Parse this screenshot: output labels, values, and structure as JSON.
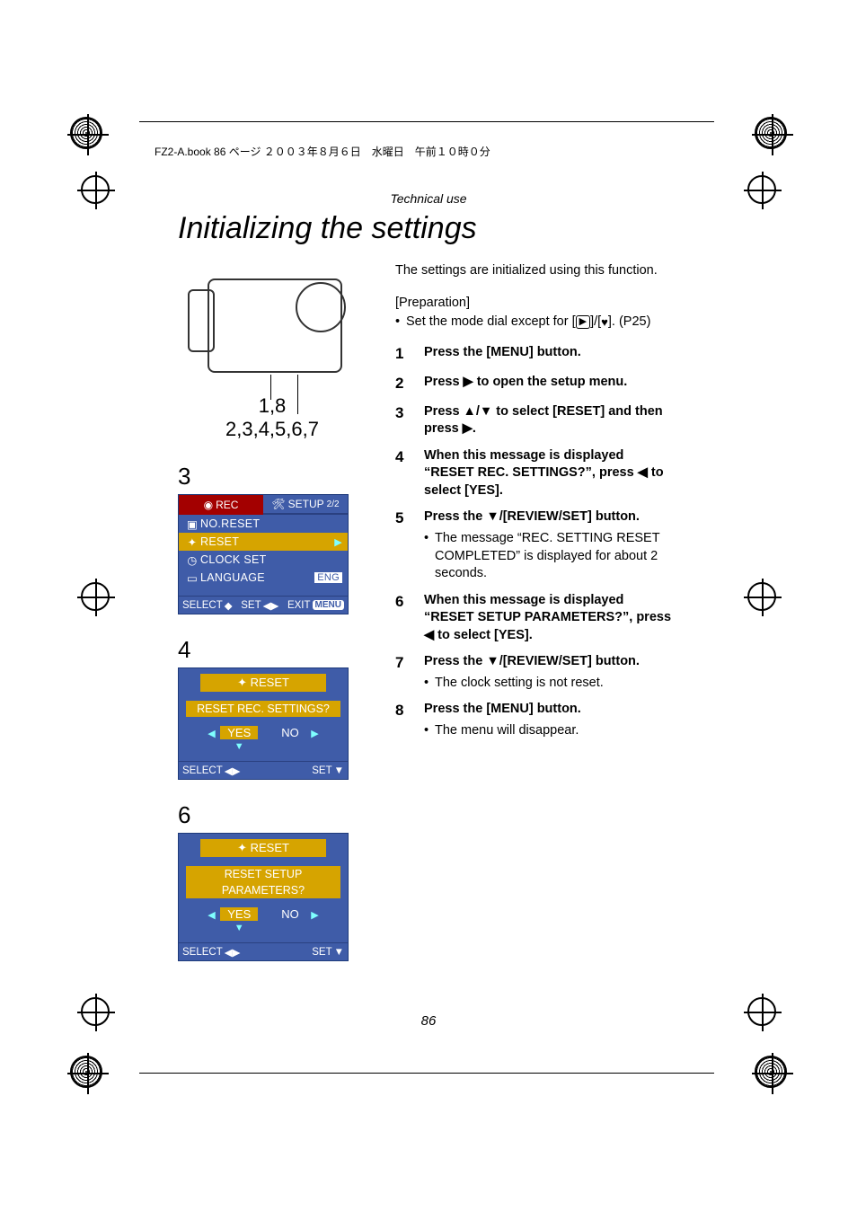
{
  "header_line": "FZ2-A.book  86 ページ  ２００３年８月６日　水曜日　午前１０時０分",
  "section_label": "Technical use",
  "page_title": "Initializing the settings",
  "camera_callouts": {
    "top": "1,8",
    "bottom": "2,3,4,5,6,7"
  },
  "fig3": {
    "number": "3",
    "tab_rec": "REC",
    "tab_setup": "SETUP",
    "tab_setup_page": "2/2",
    "items": [
      {
        "icon": "no-reset-icon",
        "label": "NO.RESET"
      },
      {
        "icon": "reset-icon",
        "label": "RESET",
        "arrow": "▶"
      },
      {
        "icon": "clock-icon",
        "label": "CLOCK SET"
      },
      {
        "icon": "language-icon",
        "label": "LANGUAGE",
        "value": "ENG"
      }
    ],
    "footer": {
      "select": "SELECT",
      "set": "SET",
      "exit": "EXIT",
      "menu": "MENU"
    }
  },
  "fig4": {
    "number": "4",
    "title": "RESET",
    "question": "RESET REC. SETTINGS?",
    "yes": "YES",
    "no": "NO",
    "footer": {
      "select": "SELECT",
      "set": "SET"
    }
  },
  "fig6": {
    "number": "6",
    "title": "RESET",
    "question_l1": "RESET SETUP",
    "question_l2": "PARAMETERS?",
    "yes": "YES",
    "no": "NO",
    "footer": {
      "select": "SELECT",
      "set": "SET"
    }
  },
  "intro": "The settings are initialized using this function.",
  "prep_head": "[Preparation]",
  "prep_line_a": "Set the mode dial except for [",
  "prep_line_b": "]/[",
  "prep_line_c": "]. (P25)",
  "steps": [
    {
      "n": "1",
      "text": "Press the [MENU] button."
    },
    {
      "n": "2",
      "pre": "Press ",
      "sym": "▶",
      "post": " to open the setup menu."
    },
    {
      "n": "3",
      "pre": "Press ",
      "sym": "▲/▼",
      "mid": " to select [RESET] and then press ",
      "sym2": "▶",
      "post": "."
    },
    {
      "n": "4",
      "pre": "When this message is displayed “RESET REC. SETTINGS?”, press ",
      "sym": "◀",
      "post": " to select [YES]."
    },
    {
      "n": "5",
      "pre": "Press the ",
      "sym": "▼",
      "post": "/[REVIEW/SET] button.",
      "sub": "The message “REC. SETTING RESET COMPLETED” is displayed for about 2 seconds."
    },
    {
      "n": "6",
      "pre": "When this message is displayed “RESET SETUP PARAMETERS?”, press ",
      "sym": "◀",
      "post": " to select [YES]."
    },
    {
      "n": "7",
      "pre": "Press the ",
      "sym": "▼",
      "post": "/[REVIEW/SET] button.",
      "sub": "The clock setting is not reset."
    },
    {
      "n": "8",
      "text": "Press the [MENU] button.",
      "sub": "The menu will disappear."
    }
  ],
  "page_number": "86"
}
